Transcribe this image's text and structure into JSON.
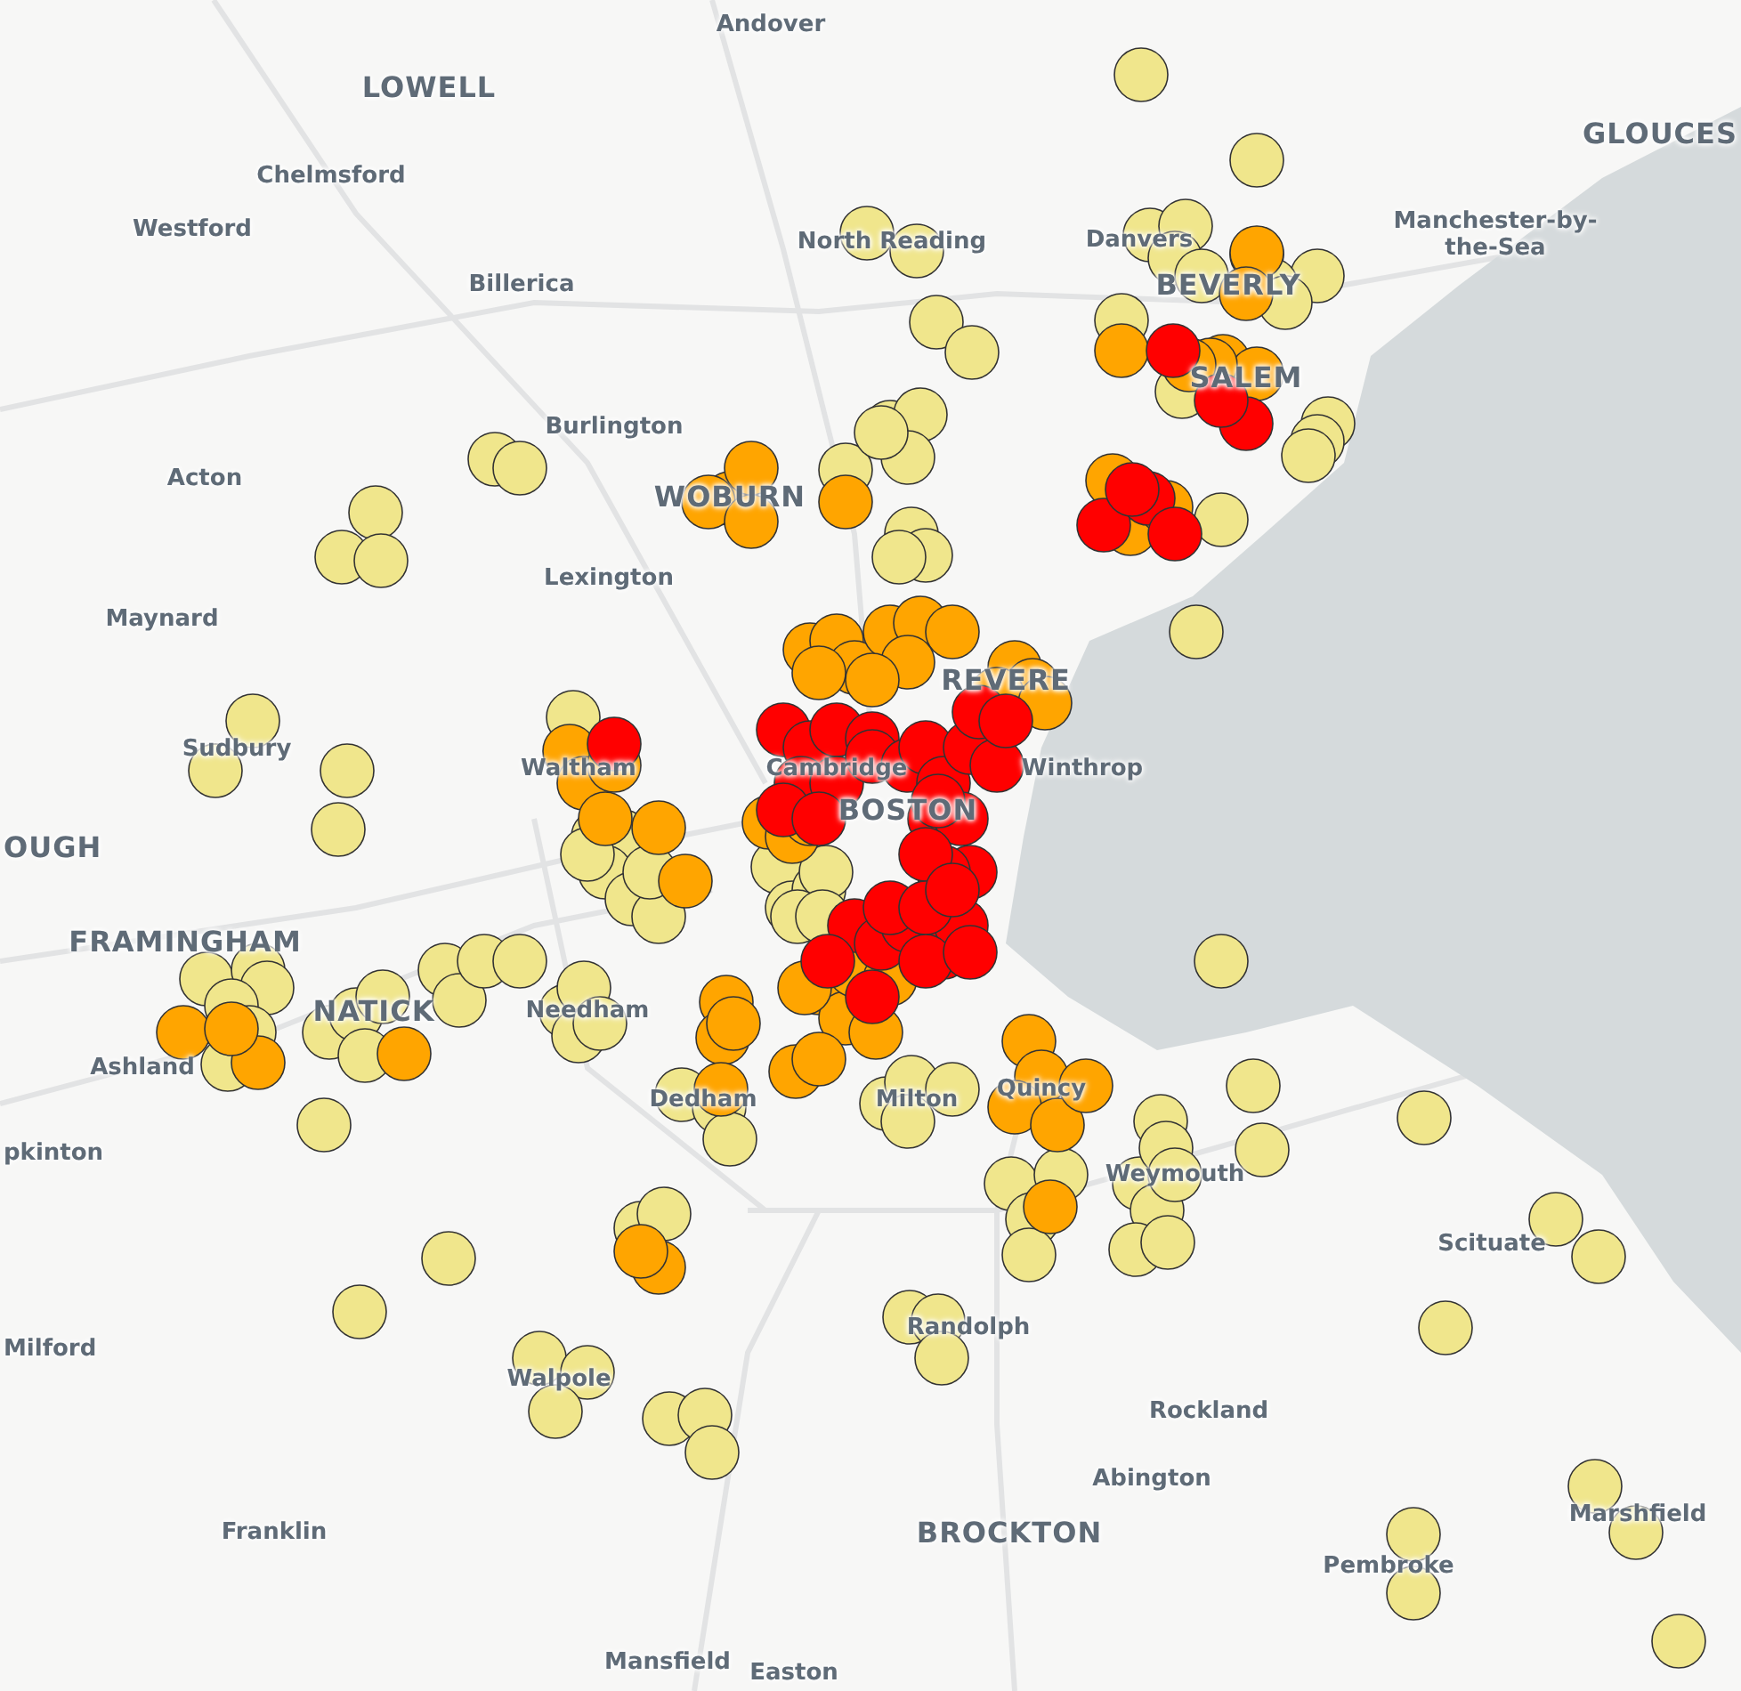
{
  "map": {
    "labels": [
      {
        "text": "Andover",
        "kind": "town"
      },
      {
        "text": "LOWELL",
        "kind": "city"
      },
      {
        "text": "GLOUCES",
        "kind": "city"
      },
      {
        "text": "Chelmsford",
        "kind": "town"
      },
      {
        "text": "Westford",
        "kind": "town"
      },
      {
        "text": "North Reading",
        "kind": "town"
      },
      {
        "text": "Danvers",
        "kind": "town"
      },
      {
        "text": "Manchester-by-the-Sea",
        "kind": "town"
      },
      {
        "text": "Billerica",
        "kind": "town"
      },
      {
        "text": "BEVERLY",
        "kind": "city"
      },
      {
        "text": "SALEM",
        "kind": "city"
      },
      {
        "text": "Burlington",
        "kind": "town"
      },
      {
        "text": "Acton",
        "kind": "town"
      },
      {
        "text": "WOBURN",
        "kind": "city"
      },
      {
        "text": "Lexington",
        "kind": "town"
      },
      {
        "text": "Maynard",
        "kind": "town"
      },
      {
        "text": "REVERE",
        "kind": "city"
      },
      {
        "text": "Sudbury",
        "kind": "town"
      },
      {
        "text": "Waltham",
        "kind": "town"
      },
      {
        "text": "Cambridge",
        "kind": "town"
      },
      {
        "text": "Winthrop",
        "kind": "town"
      },
      {
        "text": "BOSTON",
        "kind": "city"
      },
      {
        "text": "OUGH",
        "kind": "city"
      },
      {
        "text": "FRAMINGHAM",
        "kind": "city"
      },
      {
        "text": "NATICK",
        "kind": "city"
      },
      {
        "text": "Needham",
        "kind": "town"
      },
      {
        "text": "Ashland",
        "kind": "town"
      },
      {
        "text": "Dedham",
        "kind": "town"
      },
      {
        "text": "Milton",
        "kind": "town"
      },
      {
        "text": "Quincy",
        "kind": "town"
      },
      {
        "text": "pkinton",
        "kind": "town"
      },
      {
        "text": "Weymouth",
        "kind": "town"
      },
      {
        "text": "Scituate",
        "kind": "town"
      },
      {
        "text": "Randolph",
        "kind": "town"
      },
      {
        "text": "Milford",
        "kind": "town"
      },
      {
        "text": "Walpole",
        "kind": "town"
      },
      {
        "text": "Rockland",
        "kind": "town"
      },
      {
        "text": "Abington",
        "kind": "town"
      },
      {
        "text": "Franklin",
        "kind": "town"
      },
      {
        "text": "BROCKTON",
        "kind": "city"
      },
      {
        "text": "Marshfield",
        "kind": "town"
      },
      {
        "text": "Pembroke",
        "kind": "town"
      },
      {
        "text": "Mansfield",
        "kind": "town"
      },
      {
        "text": "Easton",
        "kind": "town"
      }
    ],
    "markers": [
      {
        "color": "#f0e68c"
      },
      {
        "color": "#f0e68c"
      },
      {
        "color": "#f0e68c"
      },
      {
        "color": "#f0e68c"
      },
      {
        "color": "#f0e68c"
      },
      {
        "color": "#f0e68c"
      },
      {
        "color": "#f0e68c"
      },
      {
        "color": "#f0e68c"
      },
      {
        "color": "#f0e68c"
      },
      {
        "color": "#f0e68c"
      },
      {
        "color": "#f0e68c"
      },
      {
        "color": "#f0e68c"
      },
      {
        "color": "#f0e68c"
      },
      {
        "color": "#f0e68c"
      },
      {
        "color": "#f0e68c"
      },
      {
        "color": "#f0e68c"
      },
      {
        "color": "#f0e68c"
      },
      {
        "color": "#f0e68c"
      },
      {
        "color": "#f0e68c"
      },
      {
        "color": "#f0e68c"
      },
      {
        "color": "#f0e68c"
      },
      {
        "color": "#f0e68c"
      },
      {
        "color": "#f0e68c"
      },
      {
        "color": "#f0e68c"
      },
      {
        "color": "#f0e68c"
      },
      {
        "color": "#f0e68c"
      },
      {
        "color": "#f0e68c"
      },
      {
        "color": "#f0e68c"
      },
      {
        "color": "#f0e68c"
      },
      {
        "color": "#f0e68c"
      },
      {
        "color": "#f0e68c"
      },
      {
        "color": "#f0e68c"
      },
      {
        "color": "#f0e68c"
      },
      {
        "color": "#f0e68c"
      },
      {
        "color": "#f0e68c"
      },
      {
        "color": "#f0e68c"
      },
      {
        "color": "#f0e68c"
      },
      {
        "color": "#f0e68c"
      },
      {
        "color": "#f0e68c"
      },
      {
        "color": "#f0e68c"
      },
      {
        "color": "#f0e68c"
      },
      {
        "color": "#f0e68c"
      },
      {
        "color": "#f0e68c"
      },
      {
        "color": "#f0e68c"
      },
      {
        "color": "#f0e68c"
      },
      {
        "color": "#f0e68c"
      },
      {
        "color": "#f0e68c"
      },
      {
        "color": "#f0e68c"
      },
      {
        "color": "#f0e68c"
      },
      {
        "color": "#f0e68c"
      },
      {
        "color": "#f0e68c"
      },
      {
        "color": "#f0e68c"
      },
      {
        "color": "#f0e68c"
      },
      {
        "color": "#f0e68c"
      },
      {
        "color": "#f0e68c"
      },
      {
        "color": "#f0e68c"
      },
      {
        "color": "#f0e68c"
      },
      {
        "color": "#f0e68c"
      },
      {
        "color": "#f0e68c"
      },
      {
        "color": "#f0e68c"
      },
      {
        "color": "#f0e68c"
      },
      {
        "color": "#f0e68c"
      },
      {
        "color": "#f0e68c"
      },
      {
        "color": "#f0e68c"
      },
      {
        "color": "#f0e68c"
      },
      {
        "color": "#f0e68c"
      },
      {
        "color": "#f0e68c"
      },
      {
        "color": "#f0e68c"
      },
      {
        "color": "#f0e68c"
      },
      {
        "color": "#f0e68c"
      },
      {
        "color": "#f0e68c"
      },
      {
        "color": "#f0e68c"
      },
      {
        "color": "#f0e68c"
      },
      {
        "color": "#f0e68c"
      },
      {
        "color": "#f0e68c"
      },
      {
        "color": "#f0e68c"
      },
      {
        "color": "#f0e68c"
      },
      {
        "color": "#f0e68c"
      },
      {
        "color": "#f0e68c"
      },
      {
        "color": "#f0e68c"
      },
      {
        "color": "#f0e68c"
      },
      {
        "color": "#f0e68c"
      },
      {
        "color": "#f0e68c"
      },
      {
        "color": "#f0e68c"
      },
      {
        "color": "#f0e68c"
      },
      {
        "color": "#f0e68c"
      },
      {
        "color": "#f0e68c"
      },
      {
        "color": "#f0e68c"
      },
      {
        "color": "#f0e68c"
      },
      {
        "color": "#f0e68c"
      },
      {
        "color": "#f0e68c"
      },
      {
        "color": "#f0e68c"
      },
      {
        "color": "#f0e68c"
      },
      {
        "color": "#f0e68c"
      },
      {
        "color": "#f0e68c"
      },
      {
        "color": "#f0e68c"
      },
      {
        "color": "#f0e68c"
      },
      {
        "color": "#f0e68c"
      },
      {
        "color": "#f0e68c"
      },
      {
        "color": "#f0e68c"
      },
      {
        "color": "#f0e68c"
      },
      {
        "color": "#f0e68c"
      },
      {
        "color": "#f0e68c"
      },
      {
        "color": "#f0e68c"
      },
      {
        "color": "#f0e68c"
      },
      {
        "color": "#f0e68c"
      },
      {
        "color": "#f0e68c"
      },
      {
        "color": "#f0e68c"
      },
      {
        "color": "#f0e68c"
      },
      {
        "color": "#f0e68c"
      },
      {
        "color": "#f0e68c"
      },
      {
        "color": "#f0e68c"
      },
      {
        "color": "#f0e68c"
      },
      {
        "color": "#f0e68c"
      },
      {
        "color": "#ffa500"
      },
      {
        "color": "#ffa500"
      },
      {
        "color": "#ffa500"
      },
      {
        "color": "#ffa500"
      },
      {
        "color": "#ffa500"
      },
      {
        "color": "#ffa500"
      },
      {
        "color": "#ffa500"
      },
      {
        "color": "#ffa500"
      },
      {
        "color": "#ffa500"
      },
      {
        "color": "#ffa500"
      },
      {
        "color": "#ffa500"
      },
      {
        "color": "#ffa500"
      },
      {
        "color": "#ffa500"
      },
      {
        "color": "#ffa500"
      },
      {
        "color": "#ffa500"
      },
      {
        "color": "#ffa500"
      },
      {
        "color": "#ffa500"
      },
      {
        "color": "#ffa500"
      },
      {
        "color": "#ffa500"
      },
      {
        "color": "#ffa500"
      },
      {
        "color": "#ffa500"
      },
      {
        "color": "#ffa500"
      },
      {
        "color": "#ffa500"
      },
      {
        "color": "#ffa500"
      },
      {
        "color": "#ffa500"
      },
      {
        "color": "#ffa500"
      },
      {
        "color": "#ffa500"
      },
      {
        "color": "#ffa500"
      },
      {
        "color": "#ffa500"
      },
      {
        "color": "#ffa500"
      },
      {
        "color": "#ffa500"
      },
      {
        "color": "#ffa500"
      },
      {
        "color": "#ffa500"
      },
      {
        "color": "#ffa500"
      },
      {
        "color": "#ffa500"
      },
      {
        "color": "#ffa500"
      },
      {
        "color": "#ffa500"
      },
      {
        "color": "#ffa500"
      },
      {
        "color": "#ffa500"
      },
      {
        "color": "#ffa500"
      },
      {
        "color": "#ffa500"
      },
      {
        "color": "#ffa500"
      },
      {
        "color": "#ffa500"
      },
      {
        "color": "#ffa500"
      },
      {
        "color": "#ffa500"
      },
      {
        "color": "#ffa500"
      },
      {
        "color": "#ffa500"
      },
      {
        "color": "#ffa500"
      },
      {
        "color": "#ffa500"
      },
      {
        "color": "#ffa500"
      },
      {
        "color": "#ffa500"
      },
      {
        "color": "#ffa500"
      },
      {
        "color": "#ffa500"
      },
      {
        "color": "#ffa500"
      },
      {
        "color": "#ffa500"
      },
      {
        "color": "#ffa500"
      },
      {
        "color": "#ffa500"
      },
      {
        "color": "#ffa500"
      },
      {
        "color": "#ffa500"
      },
      {
        "color": "#ffa500"
      },
      {
        "color": "#ffa500"
      },
      {
        "color": "#ff0000"
      },
      {
        "color": "#ff0000"
      },
      {
        "color": "#ff0000"
      },
      {
        "color": "#ff0000"
      },
      {
        "color": "#ff0000"
      },
      {
        "color": "#ff0000"
      },
      {
        "color": "#ff0000"
      },
      {
        "color": "#ff0000"
      },
      {
        "color": "#ff0000"
      },
      {
        "color": "#ff0000"
      },
      {
        "color": "#ff0000"
      },
      {
        "color": "#ff0000"
      },
      {
        "color": "#ff0000"
      },
      {
        "color": "#ff0000"
      },
      {
        "color": "#ff0000"
      },
      {
        "color": "#ff0000"
      },
      {
        "color": "#ff0000"
      },
      {
        "color": "#ff0000"
      },
      {
        "color": "#ff0000"
      },
      {
        "color": "#ff0000"
      },
      {
        "color": "#ff0000"
      },
      {
        "color": "#ff0000"
      },
      {
        "color": "#ff0000"
      },
      {
        "color": "#ff0000"
      },
      {
        "color": "#ff0000"
      },
      {
        "color": "#ff0000"
      },
      {
        "color": "#ff0000"
      },
      {
        "color": "#ff0000"
      },
      {
        "color": "#ff0000"
      },
      {
        "color": "#ff0000"
      },
      {
        "color": "#ff0000"
      },
      {
        "color": "#ff0000"
      },
      {
        "color": "#ff0000"
      },
      {
        "color": "#ff0000"
      },
      {
        "color": "#ff0000"
      },
      {
        "color": "#ff0000"
      },
      {
        "color": "#ff0000"
      },
      {
        "color": "#ff0000"
      },
      {
        "color": "#ff0000"
      },
      {
        "color": "#ff0000"
      },
      {
        "color": "#ff0000"
      },
      {
        "color": "#ff0000"
      }
    ]
  }
}
